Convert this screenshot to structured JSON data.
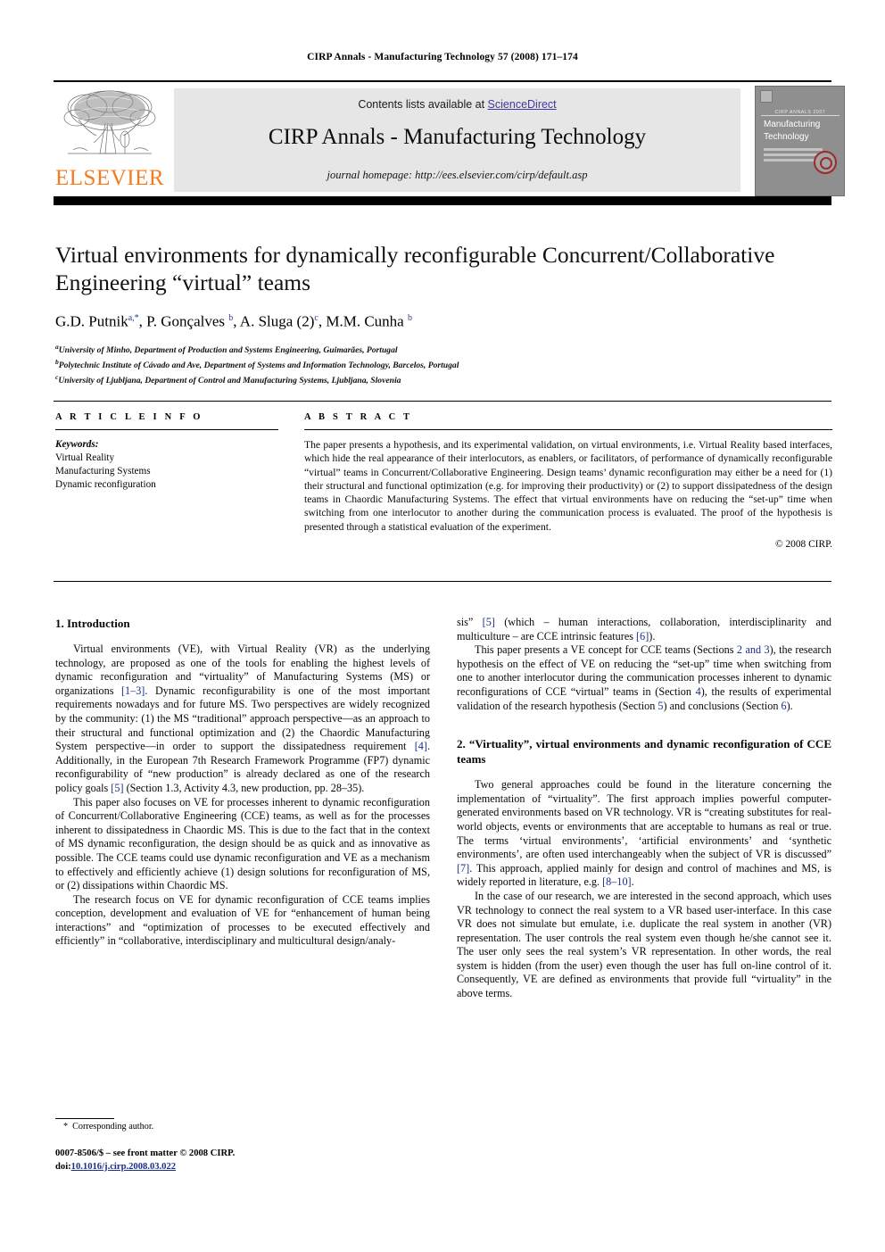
{
  "running_head": "CIRP Annals - Manufacturing Technology 57 (2008) 171–174",
  "masthead": {
    "contents_prefix": "Contents lists available at ",
    "sciencedirect": "ScienceDirect",
    "journal_title": "CIRP Annals - Manufacturing Technology",
    "homepage": "journal homepage: http://ees.elsevier.com/cirp/default.asp",
    "publisher_wordmark": "ELSEVIER",
    "publisher_color": "#F47B20",
    "link_color": "#3b3b9e",
    "band_color": "#e6e6e6",
    "cover": {
      "series": "CIRP ANNALS 2007",
      "title_line1": "Manufacturing",
      "title_line2": "Technology"
    }
  },
  "article": {
    "title": "Virtual environments for dynamically reconfigurable Concurrent/Collaborative Engineering “virtual” teams",
    "authors_html": "G.D. Putnik<sup>a,*</sup>, P. Gonçalves <sup>b</sup>, A. Sluga (2)<sup>c</sup>, M.M. Cunha <sup>b</sup>",
    "affiliations": [
      {
        "marker": "a",
        "text": "University of Minho, Department of Production and Systems Engineering, Guimarães, Portugal"
      },
      {
        "marker": "b",
        "text": "Polytechnic Institute of Cávado and Ave, Department of Systems and Information Technology, Barcelos, Portugal"
      },
      {
        "marker": "c",
        "text": "University of Ljubljana, Department of Control and Manufacturing Systems, Ljubljana, Slovenia"
      }
    ]
  },
  "article_info": {
    "heading": "A R T I C L E  I N F O",
    "keywords_label": "Keywords:",
    "keywords": [
      "Virtual Reality",
      "Manufacturing Systems",
      "Dynamic reconfiguration"
    ]
  },
  "abstract": {
    "heading": "A B S T R A C T",
    "body": "The paper presents a hypothesis, and its experimental validation, on virtual environments, i.e. Virtual Reality based interfaces, which hide the real appearance of their interlocutors, as enablers, or facilitators, of performance of dynamically reconfigurable “virtual” teams in Concurrent/Collaborative Engineering. Design teams’ dynamic reconfiguration may either be a need for (1) their structural and functional optimization (e.g. for improving their productivity) or (2) to support dissipatedness of the design teams in Chaordic Manufacturing Systems. The effect that virtual environments have on reducing the “set-up” time when switching from one interlocutor to another during the communication process is evaluated. The proof of the hypothesis is presented through a statistical evaluation of the experiment.",
    "copyright": "© 2008 CIRP."
  },
  "body": {
    "section1_heading": "1. Introduction",
    "section2_heading": "2. “Virtuality”, virtual environments and dynamic reconfiguration of CCE teams",
    "left_paragraphs": [
      "Virtual environments (VE), with Virtual Reality (VR) as the underlying technology, are proposed as one of the tools for enabling the highest levels of dynamic reconfiguration and “virtuality” of Manufacturing Systems (MS) or organizations [1–3]. Dynamic reconfigurability is one of the most important requirements nowadays and for future MS. Two perspectives are widely recognized by the community: (1) the MS “traditional” approach perspective—as an approach to their structural and functional optimization and (2) the Chaordic Manufacturing System perspective—in order to support the dissipatedness requirement [4]. Additionally, in the European 7th Research Framework Programme (FP7) dynamic reconfigurability of “new production” is already declared as one of the research policy goals [5] (Section 1.3, Activity 4.3, new production, pp. 28–35).",
      "This paper also focuses on VE for processes inherent to dynamic reconfiguration of Concurrent/Collaborative Engineering (CCE) teams, as well as for the processes inherent to dissipatedness in Chaordic MS. This is due to the fact that in the context of MS dynamic reconfiguration, the design should be as quick and as innovative as possible. The CCE teams could use dynamic reconfiguration and VE as a mechanism to effectively and efficiently achieve (1) design solutions for reconfiguration of MS, or (2) dissipations within Chaordic MS.",
      "The research focus on VE for dynamic reconfiguration of CCE teams implies conception, development and evaluation of VE for “enhancement of human being interactions” and “optimization of processes to be executed effectively and efficiently” in “collaborative, interdisciplinary and multicultural design/analy-"
    ],
    "right_paragraphs": [
      "sis” [5] (which – human interactions, collaboration, interdisciplinarity and multiculture – are CCE intrinsic features [6]).",
      "This paper presents a VE concept for CCE teams (Sections 2 and 3), the research hypothesis on the effect of VE on reducing the “set-up” time when switching from one to another interlocutor during the communication processes inherent to dynamic reconfigurations of CCE “virtual” teams in (Section 4), the results of experimental validation of the research hypothesis (Section 5) and conclusions (Section 6).",
      "Two general approaches could be found in the literature concerning the implementation of “virtuality”. The first approach implies powerful computer-generated environments based on VR technology. VR is “creating substitutes for real-world objects, events or environments that are acceptable to humans as real or true. The terms ‘virtual environments’, ‘artificial environments’ and ‘synthetic environments’, are often used interchangeably when the subject of VR is discussed” [7]. This approach, applied mainly for design and control of machines and MS, is widely reported in literature, e.g. [8–10].",
      "In the case of our research, we are interested in the second approach, which uses VR technology to connect the real system to a VR based user-interface. In this case VR does not simulate but emulate, i.e. duplicate the real system in another (VR) representation. The user controls the real system even though he/she cannot see it. The user only sees the real system’s VR representation. In other words, the real system is hidden (from the user) even though the user has full on-line control of it. Consequently, VE are defined as environments that provide full “virtuality” in the above terms."
    ]
  },
  "footnote": {
    "star": "*",
    "text": "Corresponding author."
  },
  "footer": {
    "line1": "0007-8506/$ – see front matter © 2008 CIRP.",
    "doi_label": "doi:",
    "doi_value": "10.1016/j.cirp.2008.03.022"
  }
}
